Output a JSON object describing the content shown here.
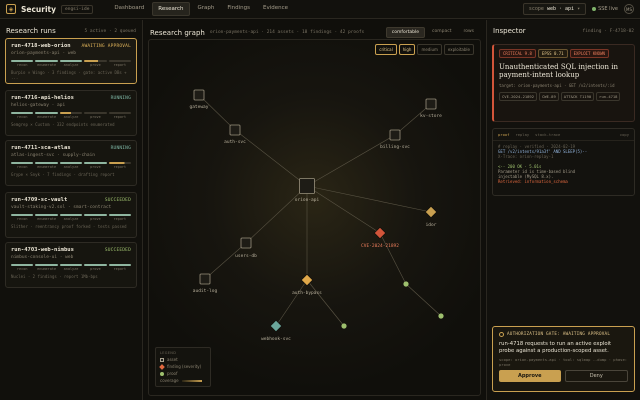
{
  "app": {
    "name": "Security",
    "tag": "engsi-ide"
  },
  "nav": [
    "Dashboard",
    "Research",
    "Graph",
    "Findings",
    "Evidence"
  ],
  "scope": {
    "label": "scope",
    "value": "web · api"
  },
  "live": "SSE live",
  "avatar": "MS",
  "runs_panel": {
    "title": "Research runs",
    "summary": "5 active · 2 queued",
    "stage_labels": [
      "recon",
      "enumerate",
      "analyze",
      "prove",
      "report"
    ],
    "runs": [
      {
        "name": "run-4718-web-orion",
        "status": "AWAITING APPROVAL",
        "status_color": "#e0b45a",
        "target": "orion-payments-api · web",
        "meta": "Burpio × Wingo · 3 findings · gate: active DBs + ...",
        "selected": true,
        "stages": [
          1,
          1,
          1,
          0.6,
          0
        ]
      },
      {
        "name": "run-4716-api-helios",
        "status": "RUNNING",
        "status_color": "#7fb8a6",
        "target": "helios-gateway · api",
        "meta": "Semgrep × Custom · 332 endpoints enumerated",
        "selected": false,
        "stages": [
          1,
          1,
          0.5,
          0,
          0
        ]
      },
      {
        "name": "run-4711-sca-atlas",
        "status": "RUNNING",
        "status_color": "#7fb8a6",
        "target": "atlas-ingest-svc · supply-chain",
        "meta": "Grype × Snyk · 7 findings · drafting report",
        "selected": false,
        "stages": [
          1,
          1,
          1,
          1,
          0.7
        ]
      },
      {
        "name": "run-4709-sc-vault",
        "status": "SUCCEEDED",
        "status_color": "#9ec06e",
        "target": "vault-staking-v2.sol · smart-contract",
        "meta": "Slither · reentrancy proof forked · tests passed",
        "selected": false,
        "stages": [
          1,
          1,
          1,
          1,
          1
        ]
      },
      {
        "name": "run-4703-web-nimbus",
        "status": "SUCCEEDED",
        "status_color": "#9ec06e",
        "target": "nimbus-console-ui · web",
        "meta": "Nuclei · 2 findings · report 1Mb-bps",
        "selected": false,
        "stages": [
          1,
          1,
          1,
          1,
          1
        ]
      }
    ]
  },
  "graph_panel": {
    "title": "Research graph",
    "subtitle": "orion-payments-api · 214 assets · 18 findings · 42 proofs",
    "density": [
      "comfortable",
      "compact",
      "rows"
    ],
    "filters": [
      "critical",
      "high",
      "medium",
      "exploitable"
    ],
    "nodes": [
      {
        "id": "gateway",
        "label": "gateway",
        "kind": "asset"
      },
      {
        "id": "auth",
        "label": "auth-svc",
        "kind": "asset"
      },
      {
        "id": "kvstore",
        "label": "kv-store",
        "kind": "asset"
      },
      {
        "id": "billing",
        "label": "billing-svc",
        "kind": "asset"
      },
      {
        "id": "orion",
        "label": "orion-api",
        "kind": "asset"
      },
      {
        "id": "cve",
        "label": "CVE-2024-21892",
        "kind": "finding",
        "severity": "critical"
      },
      {
        "id": "idor",
        "label": "idor",
        "kind": "finding",
        "severity": "medium"
      },
      {
        "id": "users",
        "label": "users-db",
        "kind": "asset"
      },
      {
        "id": "audit",
        "label": "audit-log",
        "kind": "asset"
      },
      {
        "id": "authbypass",
        "label": "auth-bypass",
        "kind": "finding",
        "severity": "high"
      },
      {
        "id": "webhook",
        "label": "webhook-svc",
        "kind": "finding",
        "severity": "info"
      },
      {
        "id": "p1",
        "label": "",
        "kind": "proof"
      },
      {
        "id": "p2",
        "label": "",
        "kind": "proof"
      },
      {
        "id": "p3",
        "label": "",
        "kind": "proof"
      }
    ],
    "edges": [
      [
        "gateway",
        "auth"
      ],
      [
        "auth",
        "orion"
      ],
      [
        "kvstore",
        "billing"
      ],
      [
        "billing",
        "orion"
      ],
      [
        "orion",
        "cve"
      ],
      [
        "orion",
        "idor"
      ],
      [
        "orion",
        "users"
      ],
      [
        "orion",
        "authbypass"
      ],
      [
        "users",
        "audit"
      ],
      [
        "authbypass",
        "webhook"
      ],
      [
        "authbypass",
        "p2"
      ],
      [
        "cve",
        "p1"
      ],
      [
        "p1",
        "p3"
      ]
    ],
    "legend": {
      "title": "LEGEND",
      "asset": "asset",
      "finding": "finding (severity)",
      "proof": "proof",
      "coverage": "coverage"
    }
  },
  "inspector": {
    "title": "Inspector",
    "id": "finding · F-4718-02",
    "badges": {
      "critical": "CRITICAL 9.8",
      "epss": "EPSS 0.71",
      "exploit": "EXPLOIT KNOWN"
    },
    "finding_title": "Unauthenticated SQL injection in payment-intent lookup",
    "target": "target: orion-payments-api · GET /v2/intents/:id",
    "tags": [
      "CVE-2024-21892",
      "CWE-89",
      "ATT&CK T1190",
      "run-4718"
    ],
    "code_tabs": [
      "proof",
      "replay",
      "stack-trace"
    ],
    "code_copy": "copy",
    "code_lines": [
      {
        "text": "# replay · verified · 2024-02-19",
        "cls": "c-dim"
      },
      {
        "text": "GET /v2/intents/91a3f' AND SLEEP(5)--",
        "cls": "c-blue"
      },
      {
        "text": "  X-Trace: orion-replay-1",
        "cls": "c-dim"
      },
      {
        "text": "",
        "cls": ""
      },
      {
        "text": "<-- 200 OK · 5.01s",
        "cls": "c-green"
      },
      {
        "text": "Parameter id is time-based blind",
        "cls": ""
      },
      {
        "text": "injectable (MySQL 8.x).",
        "cls": ""
      },
      {
        "text": "Retrieved: information_schema",
        "cls": "c-warn"
      }
    ],
    "gate": {
      "title": "AUTHORIZATION GATE: AWAITING APPROVAL",
      "text": "run-4718 requests to run an active exploit probe against a production-scoped asset.",
      "meta": "scope: orion-payments-api · tool: sqlmap --dump · phase: prove",
      "approve": "Approve",
      "deny": "Deny"
    }
  },
  "colors": {
    "accent": "#c9a050",
    "critical": "#d2553a",
    "high": "#e0a84a",
    "medium": "#c9a050",
    "proof": "#9ec06e",
    "info": "#6aa59a"
  }
}
